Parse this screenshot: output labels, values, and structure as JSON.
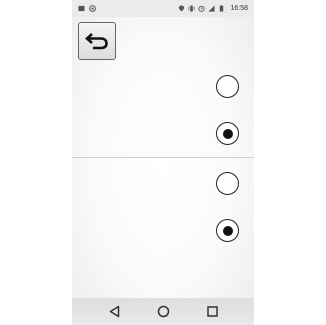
{
  "status_bar": {
    "time": "16:58",
    "left_icons": [
      "notification-image-icon",
      "notification-app-icon"
    ],
    "right_icons": [
      "location-icon",
      "vibrate-icon",
      "alarm-icon",
      "signal-icon",
      "battery-icon"
    ]
  },
  "toolbar": {
    "back_icon": "undo-arrow-icon"
  },
  "options": [
    {
      "selected": false
    },
    {
      "selected": true
    },
    {
      "selected": false
    },
    {
      "selected": true
    }
  ],
  "nav_bar": {
    "icons": [
      "back-triangle-icon",
      "home-circle-icon",
      "recents-square-icon"
    ]
  },
  "colors": {
    "status_bar_bg": "#ebebeb",
    "radio_border": "#222222",
    "radio_fill": "#111111",
    "divider": "#cfcfcf"
  }
}
